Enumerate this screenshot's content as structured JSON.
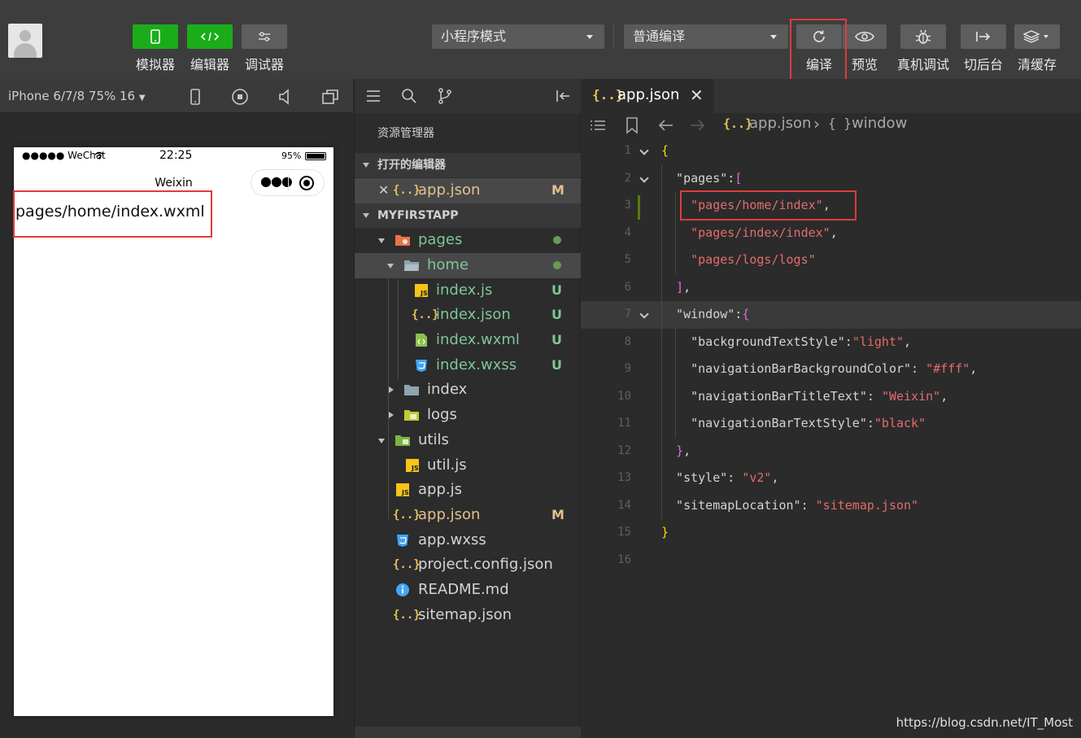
{
  "toolbar": {
    "modes": [
      {
        "label": "模拟器"
      },
      {
        "label": "编辑器"
      },
      {
        "label": "调试器"
      }
    ],
    "mode_select": "小程序模式",
    "compile_select": "普通编译",
    "actions": [
      {
        "label": "编译",
        "icon": "refresh-icon"
      },
      {
        "label": "预览",
        "icon": "eye-icon"
      },
      {
        "label": "真机调试",
        "icon": "bug-icon"
      },
      {
        "label": "切后台",
        "icon": "switch-background-icon"
      },
      {
        "label": "清缓存",
        "icon": "layers-icon"
      }
    ],
    "accent": "#1aad19",
    "highlight": "#e03b3b"
  },
  "simulator": {
    "device": "iPhone 6/7/8 75% 16",
    "status_carrier": "●●●●● WeChat",
    "status_time": "22:25",
    "status_battery": "95%",
    "nav_title": "Weixin",
    "page_text": "pages/home/index.wxml"
  },
  "explorer": {
    "title": "资源管理器",
    "open_editors_label": "打开的编辑器",
    "open_file": {
      "name": "app.json",
      "badge": "M"
    },
    "project_label": "MYFIRSTAPP",
    "tree": [
      {
        "name": "pages",
        "status": "dot"
      },
      {
        "name": "home",
        "status": "dot"
      },
      {
        "name": "index.js",
        "status": "U"
      },
      {
        "name": "index.json",
        "status": "U"
      },
      {
        "name": "index.wxml",
        "status": "U"
      },
      {
        "name": "index.wxss",
        "status": "U"
      },
      {
        "name": "index",
        "status": ""
      },
      {
        "name": "logs",
        "status": ""
      },
      {
        "name": "utils",
        "status": ""
      },
      {
        "name": "util.js",
        "status": ""
      },
      {
        "name": "app.js",
        "status": ""
      },
      {
        "name": "app.json",
        "status": "M"
      },
      {
        "name": "app.wxss",
        "status": ""
      },
      {
        "name": "project.config.json",
        "status": ""
      },
      {
        "name": "README.md",
        "status": ""
      },
      {
        "name": "sitemap.json",
        "status": ""
      }
    ]
  },
  "editor": {
    "tab_icon": "{..}",
    "tab_name": "app.json",
    "tab_close": "✕",
    "crumb_icon": "{..}",
    "crumb_file": "app.json",
    "crumb_sep": "›",
    "crumb_obj_icon": "{ }",
    "crumb_obj": "window",
    "lines": [
      {
        "n": "1",
        "parts": [
          [
            "b1",
            "{"
          ]
        ]
      },
      {
        "n": "2",
        "parts": [
          [
            "p",
            "  \"pages\":"
          ],
          [
            "b2",
            "["
          ]
        ]
      },
      {
        "n": "3",
        "parts": [
          [
            "p",
            "    "
          ],
          [
            "s",
            "\"pages/home/index\""
          ],
          [
            "p",
            ","
          ]
        ]
      },
      {
        "n": "4",
        "parts": [
          [
            "p",
            "    "
          ],
          [
            "s",
            "\"pages/index/index\""
          ],
          [
            "p",
            ","
          ]
        ]
      },
      {
        "n": "5",
        "parts": [
          [
            "p",
            "    "
          ],
          [
            "s",
            "\"pages/logs/logs\""
          ]
        ]
      },
      {
        "n": "6",
        "parts": [
          [
            "p",
            "  "
          ],
          [
            "b2",
            "]"
          ],
          [
            "p",
            ","
          ]
        ]
      },
      {
        "n": "7",
        "parts": [
          [
            "p",
            "  \"window\":"
          ],
          [
            "b2",
            "{"
          ]
        ]
      },
      {
        "n": "8",
        "parts": [
          [
            "p",
            "    \"backgroundTextStyle\":"
          ],
          [
            "s",
            "\"light\""
          ],
          [
            "p",
            ","
          ]
        ]
      },
      {
        "n": "9",
        "parts": [
          [
            "p",
            "    \"navigationBarBackgroundColor\": "
          ],
          [
            "s",
            "\"#fff\""
          ],
          [
            "p",
            ","
          ]
        ]
      },
      {
        "n": "10",
        "parts": [
          [
            "p",
            "    \"navigationBarTitleText\": "
          ],
          [
            "s",
            "\"Weixin\""
          ],
          [
            "p",
            ","
          ]
        ]
      },
      {
        "n": "11",
        "parts": [
          [
            "p",
            "    \"navigationBarTextStyle\":"
          ],
          [
            "s",
            "\"black\""
          ]
        ]
      },
      {
        "n": "12",
        "parts": [
          [
            "p",
            "  "
          ],
          [
            "b2",
            "}"
          ],
          [
            "p",
            ","
          ]
        ]
      },
      {
        "n": "13",
        "parts": [
          [
            "p",
            "  \"style\": "
          ],
          [
            "s",
            "\"v2\""
          ],
          [
            "p",
            ","
          ]
        ]
      },
      {
        "n": "14",
        "parts": [
          [
            "p",
            "  \"sitemapLocation\": "
          ],
          [
            "s",
            "\"sitemap.json\""
          ]
        ]
      },
      {
        "n": "15",
        "parts": [
          [
            "b1",
            "}"
          ]
        ]
      },
      {
        "n": "16",
        "parts": []
      }
    ]
  },
  "watermark": "https://blog.csdn.net/IT_Most"
}
